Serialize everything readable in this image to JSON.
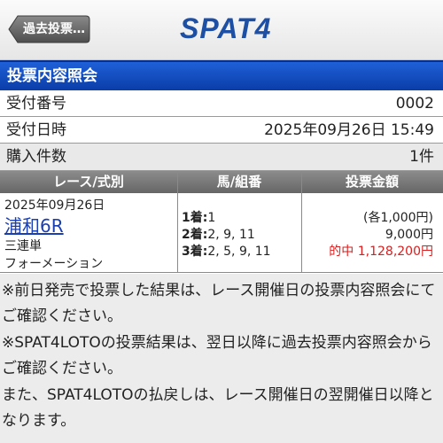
{
  "header": {
    "back_label": "過去投票…",
    "logo_text": "SPAT4"
  },
  "title": "投票内容照会",
  "info_rows": [
    {
      "label": "受付番号",
      "value": "0002"
    },
    {
      "label": "受付日時",
      "value": "2025年09月26日 15:49"
    },
    {
      "label": "購入件数",
      "value": "1件"
    }
  ],
  "table": {
    "headers": [
      "レース/式別",
      "馬/組番",
      "投票金額"
    ],
    "row": {
      "date": "2025年09月26日",
      "race": "浦和6R",
      "bet_type": "三連単",
      "method": "フォーメーション",
      "place1_label": "1着:",
      "place1_value": "1",
      "place2_label": "2着:",
      "place2_value": "2, 9, 11",
      "place3_label": "3着:",
      "place3_value": "2, 5, 9, 11",
      "unit_amount": "(各1,000円)",
      "total_amount": "9,000円",
      "hit_text": "的中 1,128,200円"
    }
  },
  "notes": [
    "※前日発売で投票した結果は、レース開催日の投票内容照会にてご確認ください。",
    "※SPAT4LOTOの投票結果は、翌日以降に過去投票内容照会からご確認ください。",
    "また、SPAT4LOTOの払戻しは、レース開催日の翌開催日以降となります。"
  ],
  "colors": {
    "title_bar": "#1549c2",
    "logo": "#1d4fa5",
    "hit": "#d81e1e",
    "link": "#1a3fb0"
  }
}
